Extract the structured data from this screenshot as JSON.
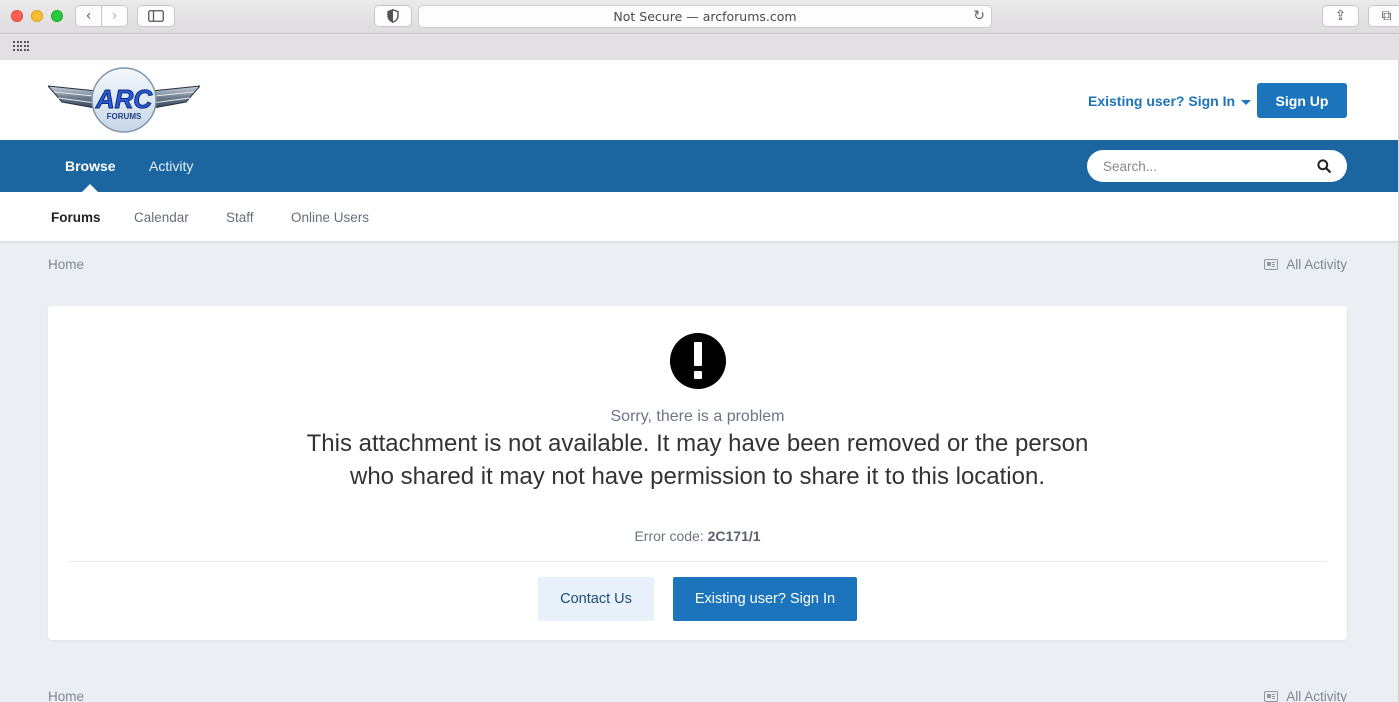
{
  "browser": {
    "url_text": "Not Secure — arcforums.com",
    "back_glyph": "‹",
    "forward_glyph": "›",
    "reload_glyph": "↻",
    "share_glyph": "⇪",
    "tabs_glyph": "⧉",
    "icons": [
      "back-icon",
      "forward-icon",
      "sidebar-icon",
      "shield-icon",
      "reload-icon",
      "share-icon",
      "tabs-icon",
      "grid-icon"
    ]
  },
  "header": {
    "logo_text": "ARC",
    "logo_subtext": "FORUMS",
    "signin_label": "Existing user? Sign In",
    "signup_label": "Sign Up"
  },
  "primary_nav": {
    "items": [
      {
        "label": "Browse",
        "active": true
      },
      {
        "label": "Activity",
        "active": false
      }
    ],
    "search_placeholder": "Search..."
  },
  "secondary_nav": {
    "items": [
      {
        "label": "Forums",
        "active": true
      },
      {
        "label": "Calendar",
        "active": false
      },
      {
        "label": "Staff",
        "active": false
      },
      {
        "label": "Online Users",
        "active": false
      }
    ]
  },
  "breadcrumb": {
    "home": "Home",
    "all_activity": "All Activity"
  },
  "error": {
    "subtitle": "Sorry, there is a problem",
    "message": "This attachment is not available. It may have been removed or the person who shared it may not have permission to share it to this location.",
    "code_label": "Error code:",
    "code_value": "2C171/1",
    "contact_label": "Contact Us",
    "signin_label": "Existing user? Sign In"
  },
  "colors": {
    "accent": "#1c75bc",
    "nav_bar": "#1b66a0",
    "page_bg": "#ebeef2"
  }
}
